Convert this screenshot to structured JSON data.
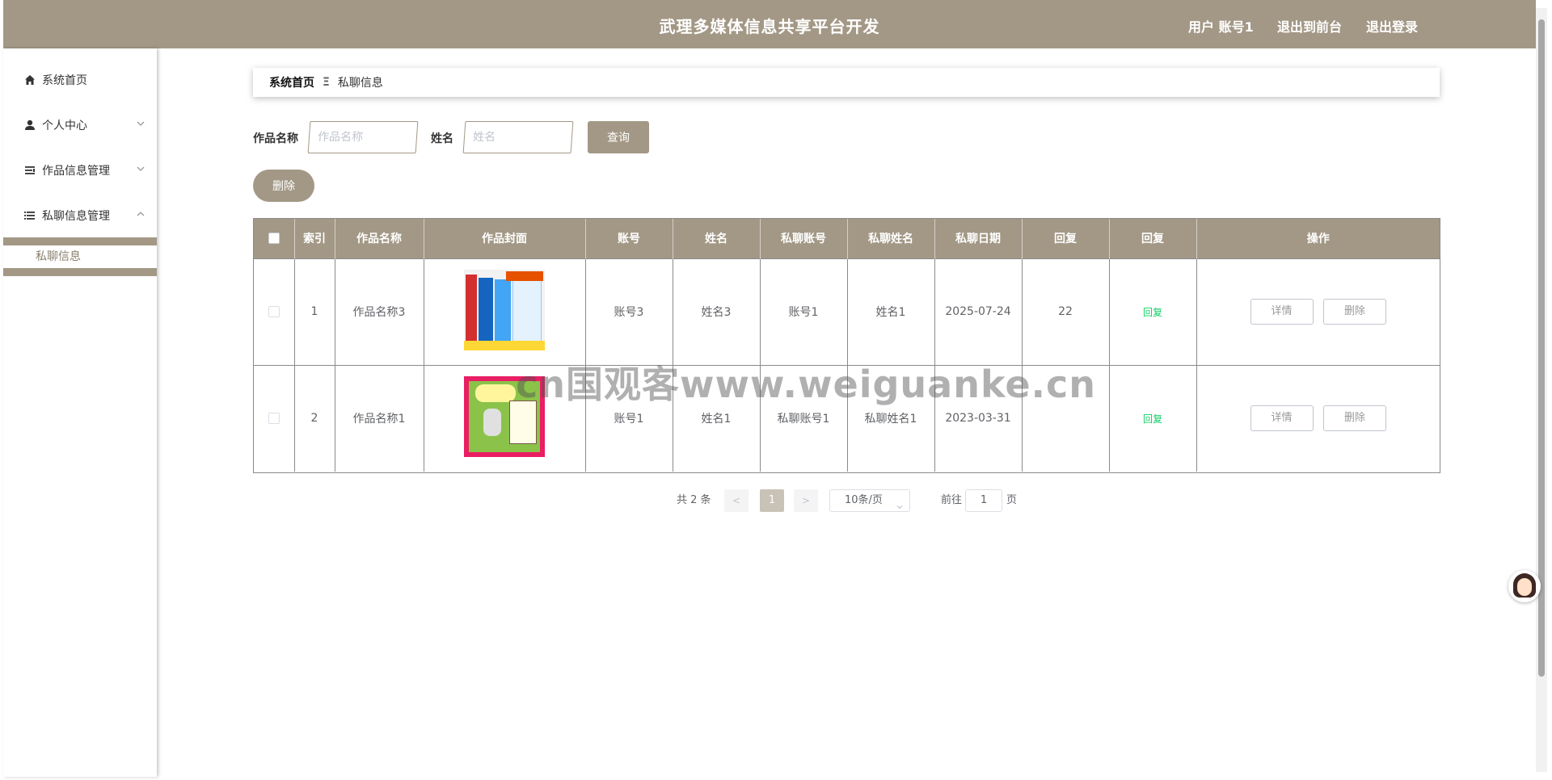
{
  "header": {
    "title": "武理多媒体信息共享平台开发",
    "user_label": "用户 账号1",
    "to_frontend": "退出到前台",
    "logout": "退出登录"
  },
  "sidebar": {
    "items": [
      {
        "label": "系统首页",
        "icon": "home-icon"
      },
      {
        "label": "个人中心",
        "icon": "user-icon"
      },
      {
        "label": "作品信息管理",
        "icon": "list-icon"
      },
      {
        "label": "私聊信息管理",
        "icon": "list-icon"
      }
    ],
    "submenu": {
      "label": "私聊信息"
    }
  },
  "breadcrumb": {
    "home": "系统首页",
    "separator": "Ξ",
    "current": "私聊信息"
  },
  "search": {
    "work_name_label": "作品名称",
    "work_name_placeholder": "作品名称",
    "name_label": "姓名",
    "name_placeholder": "姓名",
    "query_button": "查询"
  },
  "batch_delete_button": "删除",
  "table": {
    "columns": [
      "索引",
      "作品名称",
      "作品封面",
      "账号",
      "姓名",
      "私聊账号",
      "私聊姓名",
      "私聊日期",
      "回复",
      "回复",
      "操作"
    ],
    "rows": [
      {
        "index": "1",
        "work_name": "作品名称3",
        "cover": "book-set-cover",
        "account": "账号3",
        "name": "姓名3",
        "chat_account": "账号1",
        "chat_name": "姓名1",
        "chat_date": "2025-07-24",
        "reply_text": "22",
        "reply_action": "回复",
        "detail": "详情",
        "delete": "删除"
      },
      {
        "index": "2",
        "work_name": "作品名称1",
        "cover": "poster-cover",
        "account": "账号1",
        "name": "姓名1",
        "chat_account": "私聊账号1",
        "chat_name": "私聊姓名1",
        "chat_date": "2023-03-31",
        "reply_text": "",
        "reply_action": "回复",
        "detail": "详情",
        "delete": "删除"
      }
    ]
  },
  "pagination": {
    "total": "共 2 条",
    "prev": "<",
    "current_page": "1",
    "next": ">",
    "page_size": "10条/页",
    "goto_label": "前往",
    "goto_value": "1",
    "page_suffix": "页"
  },
  "watermark": "cn国观客www.weiguanke.cn",
  "colors": {
    "accent": "#a39886",
    "reply": "#13ce66"
  }
}
